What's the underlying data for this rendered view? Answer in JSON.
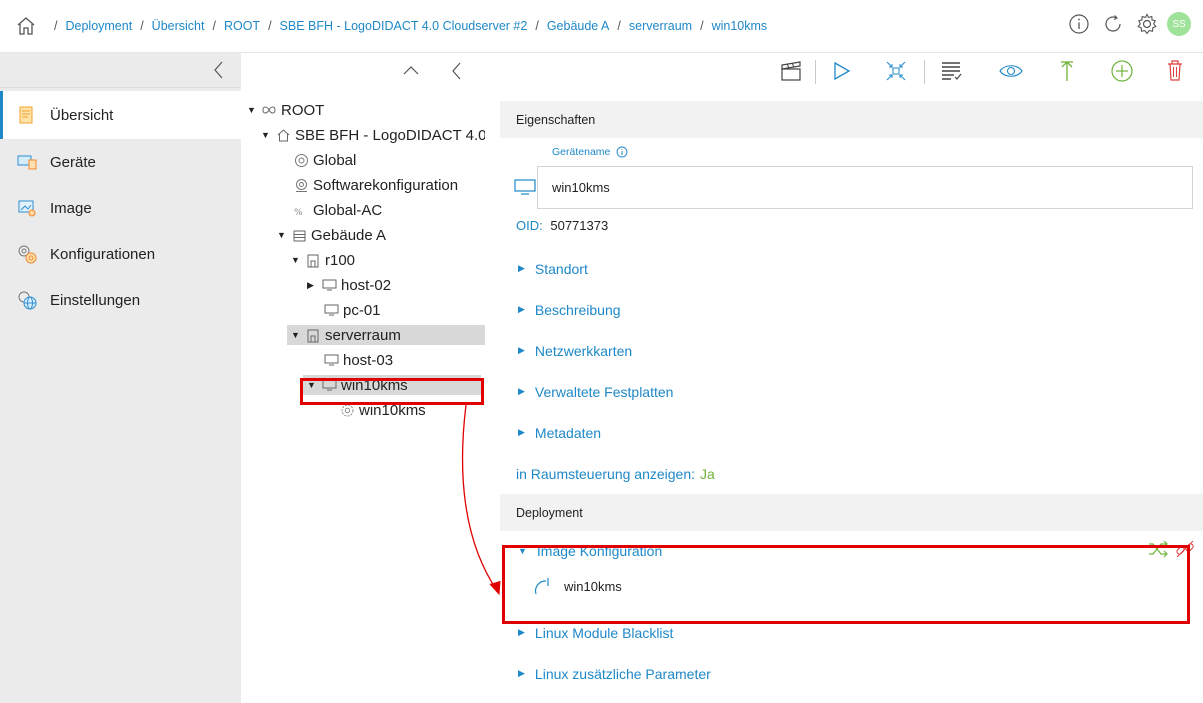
{
  "breadcrumb": {
    "items": [
      "Deployment",
      "Übersicht",
      "ROOT",
      "SBE BFH - LogoDIDACT 4.0 Cloudserver #2",
      "Gebäude A",
      "serverraum",
      "win10kms"
    ],
    "separator": "/"
  },
  "header": {
    "avatar_initials": "SS"
  },
  "sidebar": {
    "items": [
      {
        "label": "Übersicht"
      },
      {
        "label": "Geräte"
      },
      {
        "label": "Image"
      },
      {
        "label": "Konfigurationen"
      },
      {
        "label": "Einstellungen"
      }
    ]
  },
  "tree": {
    "root": "ROOT",
    "server": "SBE BFH - LogoDIDACT 4.0",
    "global": "Global",
    "softwarekonfiguration": "Softwarekonfiguration",
    "global_ac": "Global-AC",
    "gebaeude": "Gebäude A",
    "r100": "r100",
    "host02": "host-02",
    "pc01": "pc-01",
    "serverraum": "serverraum",
    "host03": "host-03",
    "win10kms": "win10kms",
    "win10kms_child": "win10kms"
  },
  "properties": {
    "section_title": "Eigenschaften",
    "device_name_label": "Gerätename",
    "device_name_value": "win10kms",
    "oid_label": "OID:",
    "oid_value": "50771373",
    "sections": [
      "Standort",
      "Beschreibung",
      "Netzwerkkarten",
      "Verwaltete Festplatten",
      "Metadaten"
    ],
    "raum_label": "in Raumsteuerung anzeigen:",
    "raum_value": "Ja"
  },
  "deployment": {
    "section_title": "Deployment",
    "image_conf_label": "Image Konfiguration",
    "image_conf_value": "win10kms",
    "sections": [
      "Linux Module Blacklist",
      "Linux zusätzliche Parameter"
    ]
  },
  "colors": {
    "accent": "#1e88c8",
    "highlight": "#e00000",
    "green": "#6fb339",
    "delete": "#e04040",
    "avatar": "#9fe39b"
  }
}
